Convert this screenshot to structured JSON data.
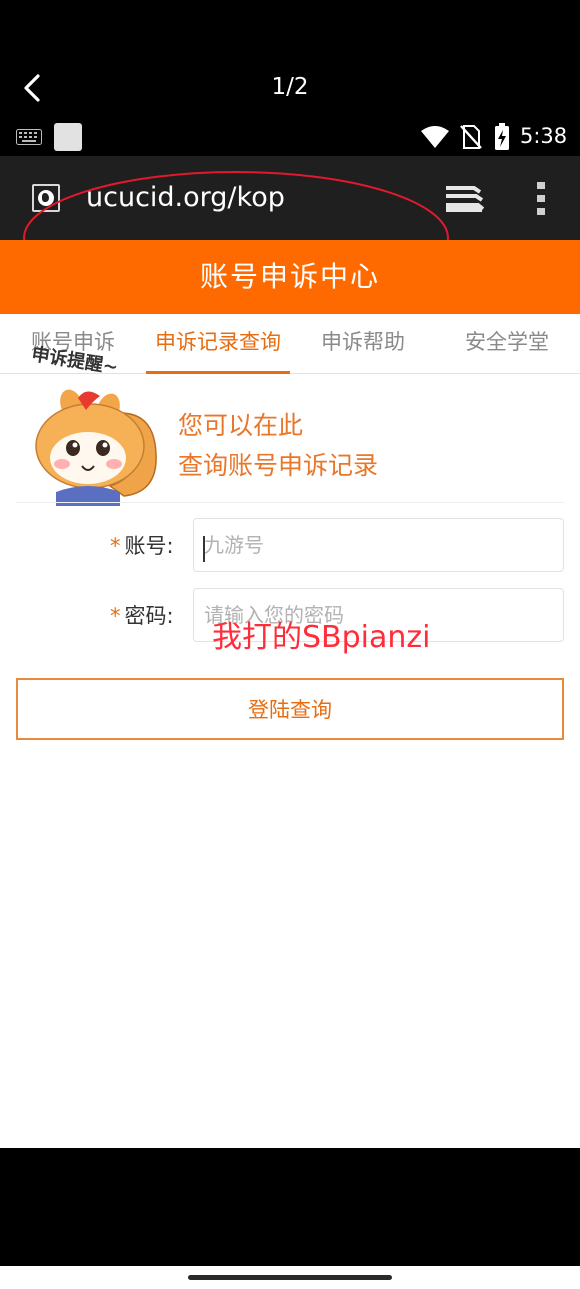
{
  "viewer": {
    "page_counter": "1/2",
    "back_icon": "chevron-left-icon"
  },
  "status_bar": {
    "time": "5:38",
    "icons": [
      "keyboard-icon",
      "image-icon",
      "wifi-icon",
      "no-sim-icon",
      "battery-charging-icon"
    ]
  },
  "browser": {
    "url": "ucucid.org/kop",
    "site_icon": "globe-page-icon",
    "tabs_icon": "tabs-stack-icon",
    "menu_icon": "more-vertical-icon"
  },
  "header": {
    "title": "账号申诉中心"
  },
  "tabs": [
    {
      "label": "账号申诉",
      "active": false
    },
    {
      "label": "申诉记录查询",
      "active": true
    },
    {
      "label": "申诉帮助",
      "active": false
    },
    {
      "label": "安全学堂",
      "active": false
    }
  ],
  "hero": {
    "sticker_text": "申诉提醒~",
    "line1": "您可以在此",
    "line2": "查询账号申诉记录",
    "mascot_icon": "squirrel-mascot"
  },
  "form": {
    "account": {
      "required_mark": "*",
      "label": "账号:",
      "placeholder": "九游号",
      "value": ""
    },
    "password": {
      "required_mark": "*",
      "label": "密码:",
      "placeholder": "请输入您的密码",
      "value": ""
    },
    "submit_label": "登陆查询"
  },
  "annotation": {
    "text": "我打的SBpianzi",
    "color": "#ff2d3a"
  },
  "colors": {
    "brand_orange": "#ff6a00",
    "accent_orange": "#e86d10"
  }
}
